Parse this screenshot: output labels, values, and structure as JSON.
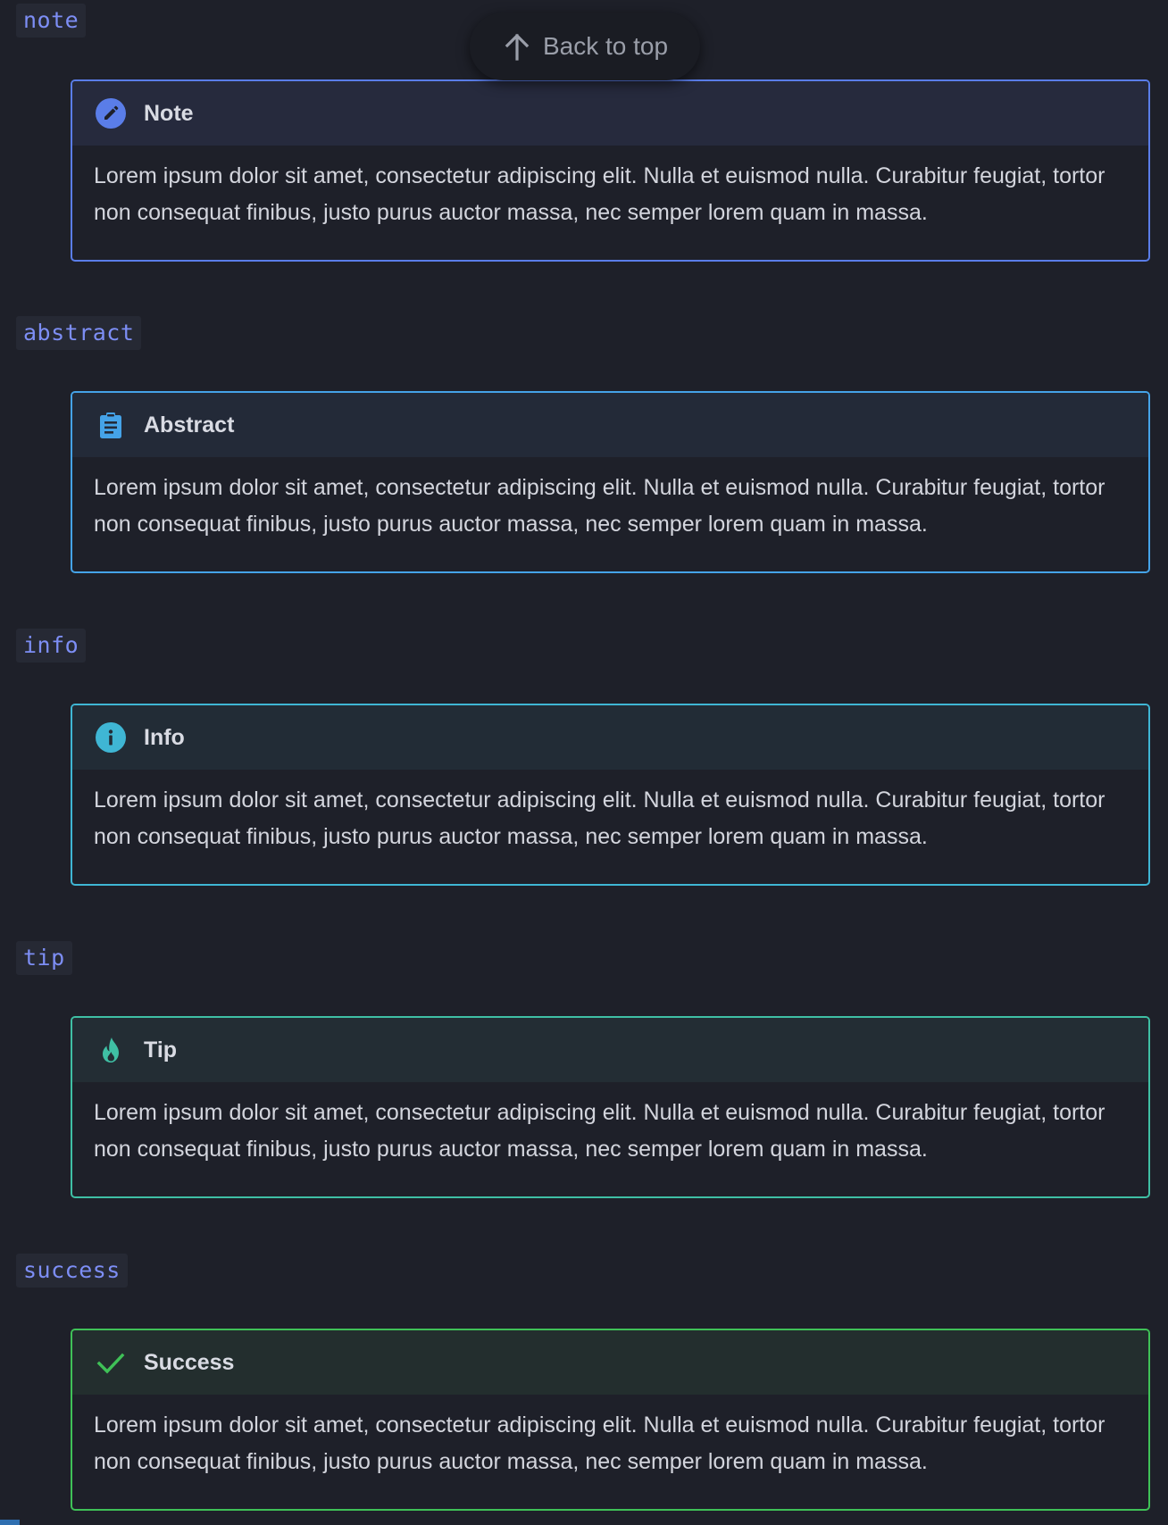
{
  "back_to_top": {
    "label": "Back to top",
    "icon": "arrow-up-icon"
  },
  "admonitions": [
    {
      "code": "note",
      "title": "Note",
      "icon": "pencil-icon",
      "color": "#5a7de8",
      "body": "Lorem ipsum dolor sit amet, consectetur adipiscing elit. Nulla et euismod nulla. Curabitur feugiat, tortor non consequat finibus, justo purus auctor massa, nec semper lorem quam in massa."
    },
    {
      "code": "abstract",
      "title": "Abstract",
      "icon": "clipboard-icon",
      "color": "#45a3e8",
      "body": "Lorem ipsum dolor sit amet, consectetur adipiscing elit. Nulla et euismod nulla. Curabitur feugiat, tortor non consequat finibus, justo purus auctor massa, nec semper lorem quam in massa."
    },
    {
      "code": "info",
      "title": "Info",
      "icon": "info-circle-icon",
      "color": "#3fb6d4",
      "body": "Lorem ipsum dolor sit amet, consectetur adipiscing elit. Nulla et euismod nulla. Curabitur feugiat, tortor non consequat finibus, justo purus auctor massa, nec semper lorem quam in massa."
    },
    {
      "code": "tip",
      "title": "Tip",
      "icon": "fire-icon",
      "color": "#3fbfa4",
      "body": "Lorem ipsum dolor sit amet, consectetur adipiscing elit. Nulla et euismod nulla. Curabitur feugiat, tortor non consequat finibus, justo purus auctor massa, nec semper lorem quam in massa."
    },
    {
      "code": "success",
      "title": "Success",
      "icon": "check-icon",
      "color": "#3fc157",
      "body": "Lorem ipsum dolor sit amet, consectetur adipiscing elit. Nulla et euismod nulla. Curabitur feugiat, tortor non consequat finibus, justo purus auctor massa, nec semper lorem quam in massa."
    }
  ]
}
